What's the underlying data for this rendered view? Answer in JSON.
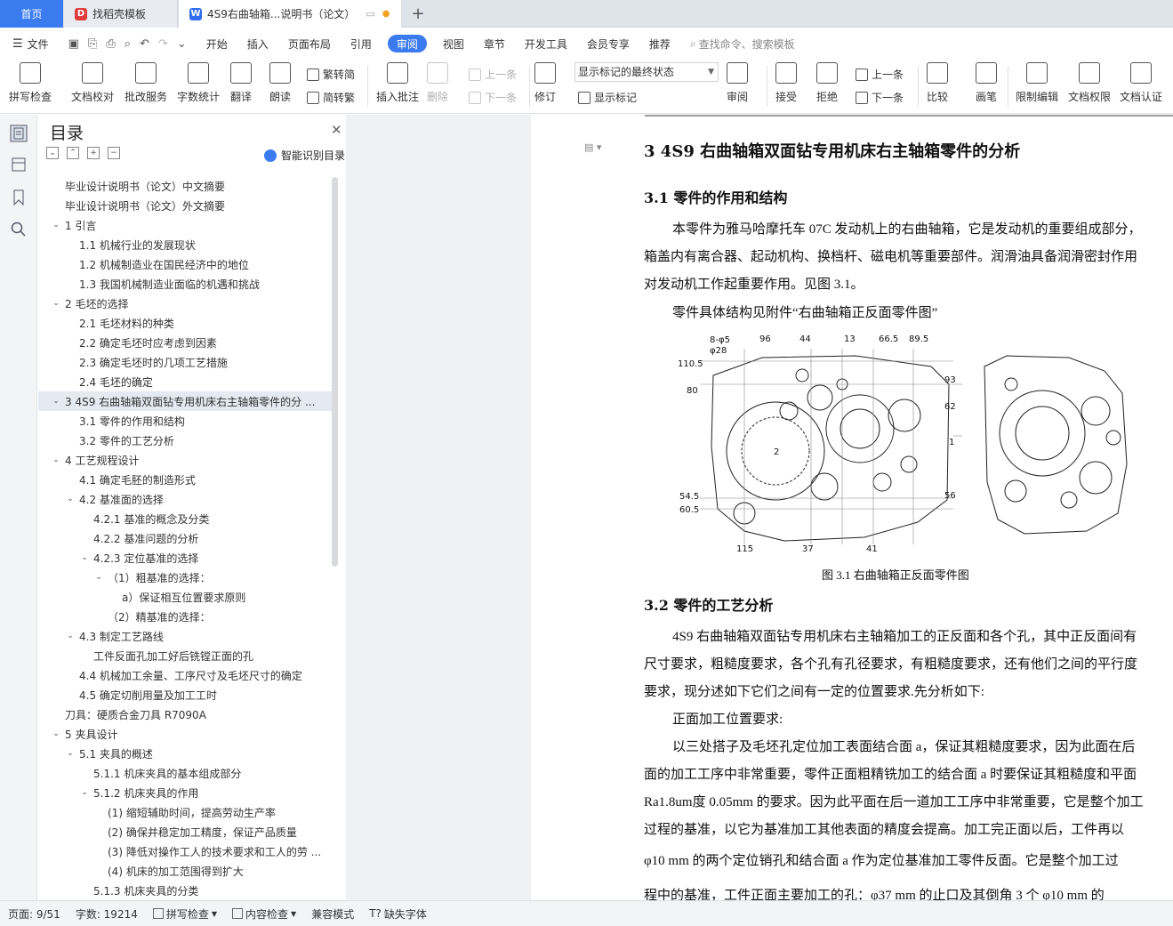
{
  "tabs": {
    "home": "首页",
    "template": "找稻壳模板",
    "document": "4S9右曲轴箱...说明书（论文）"
  },
  "menu": {
    "file": "文件",
    "items": [
      "开始",
      "插入",
      "页面布局",
      "引用",
      "审阅",
      "视图",
      "章节",
      "开发工具",
      "会员专享",
      "推荐"
    ],
    "search": "查找命令、搜索模板"
  },
  "ribbon": {
    "spell": "拼写检查",
    "proof": "文档校对",
    "batch": "批改服务",
    "wordcount": "字数统计",
    "translate": "翻译",
    "read": "朗读",
    "to_trad": "繁转简",
    "to_simp": "简转繁",
    "insert_comment": "插入批注",
    "delete": "删除",
    "prev": "上一条",
    "next": "下一条",
    "revise": "修订",
    "markup_state": "显示标记的最终状态",
    "show_markup": "显示标记",
    "review": "审阅",
    "accept": "接受",
    "reject": "拒绝",
    "prev2": "上一条",
    "next2": "下一条",
    "compare": "比较",
    "pen": "画笔",
    "restrict": "限制编辑",
    "permission": "文档权限",
    "certify": "文档认证"
  },
  "nav": {
    "title": "目录",
    "smart": "智能识别目录",
    "toc": [
      {
        "t": "毕业设计说明书（论文）中文摘要",
        "lvl": 0,
        "caret": ""
      },
      {
        "t": "毕业设计说明书（论文）外文摘要",
        "lvl": 0,
        "caret": ""
      },
      {
        "t": "1   引言",
        "lvl": 0,
        "caret": "v"
      },
      {
        "t": "1.1   机械行业的发展现状",
        "lvl": 1,
        "caret": ""
      },
      {
        "t": "1.2   机械制造业在国民经济中的地位",
        "lvl": 1,
        "caret": ""
      },
      {
        "t": "1.3   我国机械制造业面临的机遇和挑战",
        "lvl": 1,
        "caret": ""
      },
      {
        "t": "2   毛坯的选择",
        "lvl": 0,
        "caret": "v"
      },
      {
        "t": "2.1   毛坯材料的种类",
        "lvl": 1,
        "caret": ""
      },
      {
        "t": "2.2   确定毛坯时应考虑到因素",
        "lvl": 1,
        "caret": ""
      },
      {
        "t": "2.3   确定毛坯时的几项工艺措施",
        "lvl": 1,
        "caret": ""
      },
      {
        "t": "2.4   毛坯的确定",
        "lvl": 1,
        "caret": ""
      },
      {
        "t": "3   4S9 右曲轴箱双面钻专用机床右主轴箱零件的分 ...",
        "lvl": 0,
        "caret": "v",
        "sel": true
      },
      {
        "t": "3.1   零件的作用和结构",
        "lvl": 1,
        "caret": ""
      },
      {
        "t": "3.2   零件的工艺分析",
        "lvl": 1,
        "caret": ""
      },
      {
        "t": "4   工艺规程设计",
        "lvl": 0,
        "caret": "v"
      },
      {
        "t": "4.1   确定毛胚的制造形式",
        "lvl": 1,
        "caret": ""
      },
      {
        "t": "4.2   基准面的选择",
        "lvl": 1,
        "caret": "v"
      },
      {
        "t": "4.2.1   基准的概念及分类",
        "lvl": 2,
        "caret": ""
      },
      {
        "t": "4.2.2   基准问题的分析",
        "lvl": 2,
        "caret": ""
      },
      {
        "t": "4.2.3   定位基准的选择",
        "lvl": 2,
        "caret": "v"
      },
      {
        "t": "（1）粗基准的选择：",
        "lvl": 3,
        "caret": "v"
      },
      {
        "t": "a）保证相互位置要求原则",
        "lvl": 4,
        "caret": ""
      },
      {
        "t": "（2）精基准的选择：",
        "lvl": 3,
        "caret": ""
      },
      {
        "t": "4.3   制定工艺路线",
        "lvl": 1,
        "caret": "v"
      },
      {
        "t": "工件反面孔加工好后铣镗正面的孔",
        "lvl": 2,
        "caret": ""
      },
      {
        "t": "4.4   机械加工余量、工序尺寸及毛坯尺寸的确定",
        "lvl": 1,
        "caret": ""
      },
      {
        "t": "4.5   确定切削用量及加工工时",
        "lvl": 1,
        "caret": ""
      },
      {
        "t": "刀具：硬质合金刀具  R7090A",
        "lvl": 0,
        "caret": ""
      },
      {
        "t": "5   夹具设计",
        "lvl": 0,
        "caret": "v"
      },
      {
        "t": "5.1   夹具的概述",
        "lvl": 1,
        "caret": "v"
      },
      {
        "t": "5.1.1   机床夹具的基本组成部分",
        "lvl": 2,
        "caret": ""
      },
      {
        "t": "5.1.2   机床夹具的作用",
        "lvl": 2,
        "caret": "v"
      },
      {
        "t": "(1) 缩短辅助时间，提高劳动生产率",
        "lvl": 3,
        "caret": ""
      },
      {
        "t": "(2) 确保并稳定加工精度，保证产品质量",
        "lvl": 3,
        "caret": ""
      },
      {
        "t": "(3) 降低对操作工人的技术要求和工人的劳 ...",
        "lvl": 3,
        "caret": ""
      },
      {
        "t": "(4) 机床的加工范围得到扩大",
        "lvl": 3,
        "caret": ""
      },
      {
        "t": "5.1.3   机床夹具的分类",
        "lvl": 2,
        "caret": ""
      }
    ]
  },
  "doc": {
    "h1": "3    4S9 右曲轴箱双面钻专用机床右主轴箱零件的分析",
    "h2a": "3.1    零件的作用和结构",
    "p1": "本零件为雅马哈摩托车 07C 发动机上的右曲轴箱，它是发动机的重要组成部分，",
    "p2": "箱盖内有离合器、起动机构、换档杆、磁电机等重要部件。润滑油具备润滑密封作用",
    "p3": "对发动机工作起重要作用。见图 3.1。",
    "p4": "零件具体结构见附件“右曲轴箱正反面零件图”",
    "caption": "图 3.1    右曲轴箱正反面零件图",
    "h2b": "3.2    零件的工艺分析",
    "q1": "4S9 右曲轴箱双面钻专用机床右主轴箱加工的正反面和各个孔，其中正反面间有",
    "q2": "尺寸要求，粗糙度要求，各个孔有孔径要求，有粗糙度要求，还有他们之间的平行度",
    "q3": "要求，现分述如下它们之间有一定的位置要求.先分析如下:",
    "q4": "正面加工位置要求:",
    "q5": "以三处搭子及毛坯孔定位加工表面结合面 a，保证其粗糙度要求，因为此面在后",
    "q6": "面的加工工序中非常重要，零件正面粗精铣加工的结合面 a 时要保证其粗糙度和平面",
    "q7": "Ra1.8um度 0.05mm 的要求。因为此平面在后一道加工工序中非常重要，它是整个加工",
    "q8": "过程的基准，以它为基准加工其他表面的精度会提高。加工完正面以后，工件再以",
    "q9": "φ10 mm 的两个定位销孔和结合面 a 作为定位基准加工零件反面。它是整个加工过",
    "q10": "程中的基准，工件正面主要加工的孔：φ37 mm 的止口及其倒角 3 个 φ10 mm 的"
  },
  "figure_labels": {
    "top": [
      "8-φ5",
      "φ28",
      "96",
      "44",
      "13",
      "66.5",
      "89.5"
    ],
    "left": [
      "110.5",
      "80",
      "54.5",
      "60.5"
    ],
    "right": [
      "93",
      "62",
      "1",
      "56"
    ],
    "bottom": [
      "115",
      "37",
      "41"
    ],
    "center": "2"
  },
  "status": {
    "page": "页面: 9/51",
    "words": "字数: 19214",
    "spell": "拼写检查",
    "content": "内容检查",
    "mode": "兼容模式",
    "font": "缺失字体"
  }
}
